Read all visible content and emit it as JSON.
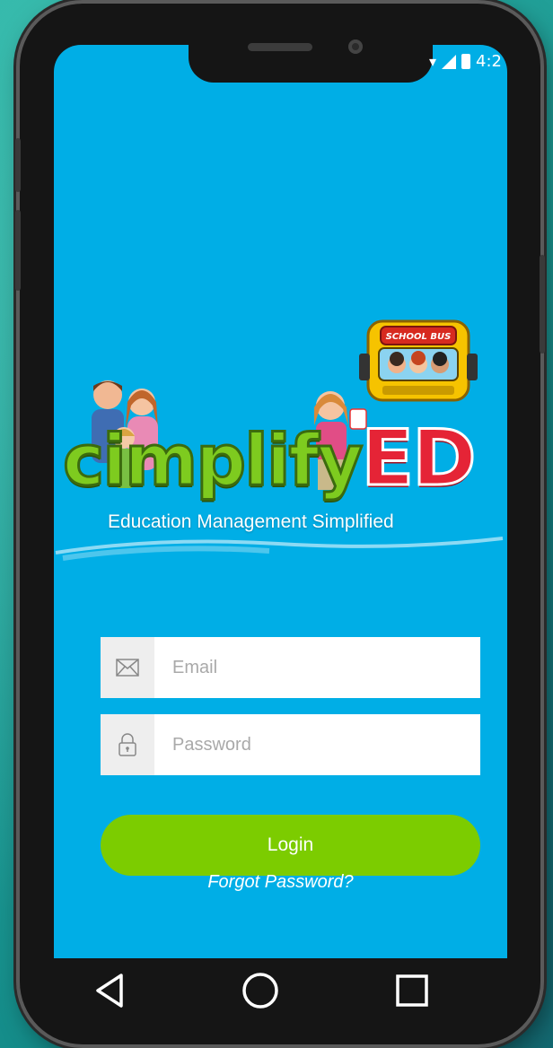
{
  "status_bar": {
    "time": "4:2"
  },
  "logo": {
    "simplify_text": "cimplify",
    "ed_text": "ED",
    "bus_sign": "SCHOOL BUS",
    "tagline": "Education Management Simplified"
  },
  "form": {
    "email": {
      "placeholder": "Email",
      "value": ""
    },
    "password": {
      "placeholder": "Password",
      "value": ""
    },
    "login_label": "Login",
    "forgot_label": "Forgot Password?"
  },
  "nav": {
    "back": "back-icon",
    "home": "home-icon",
    "recents": "recents-icon"
  },
  "colors": {
    "screen_bg": "#00aee6",
    "login_button": "#7ccc00",
    "brand_green": "#7ecb1f",
    "brand_red": "#e52436"
  }
}
